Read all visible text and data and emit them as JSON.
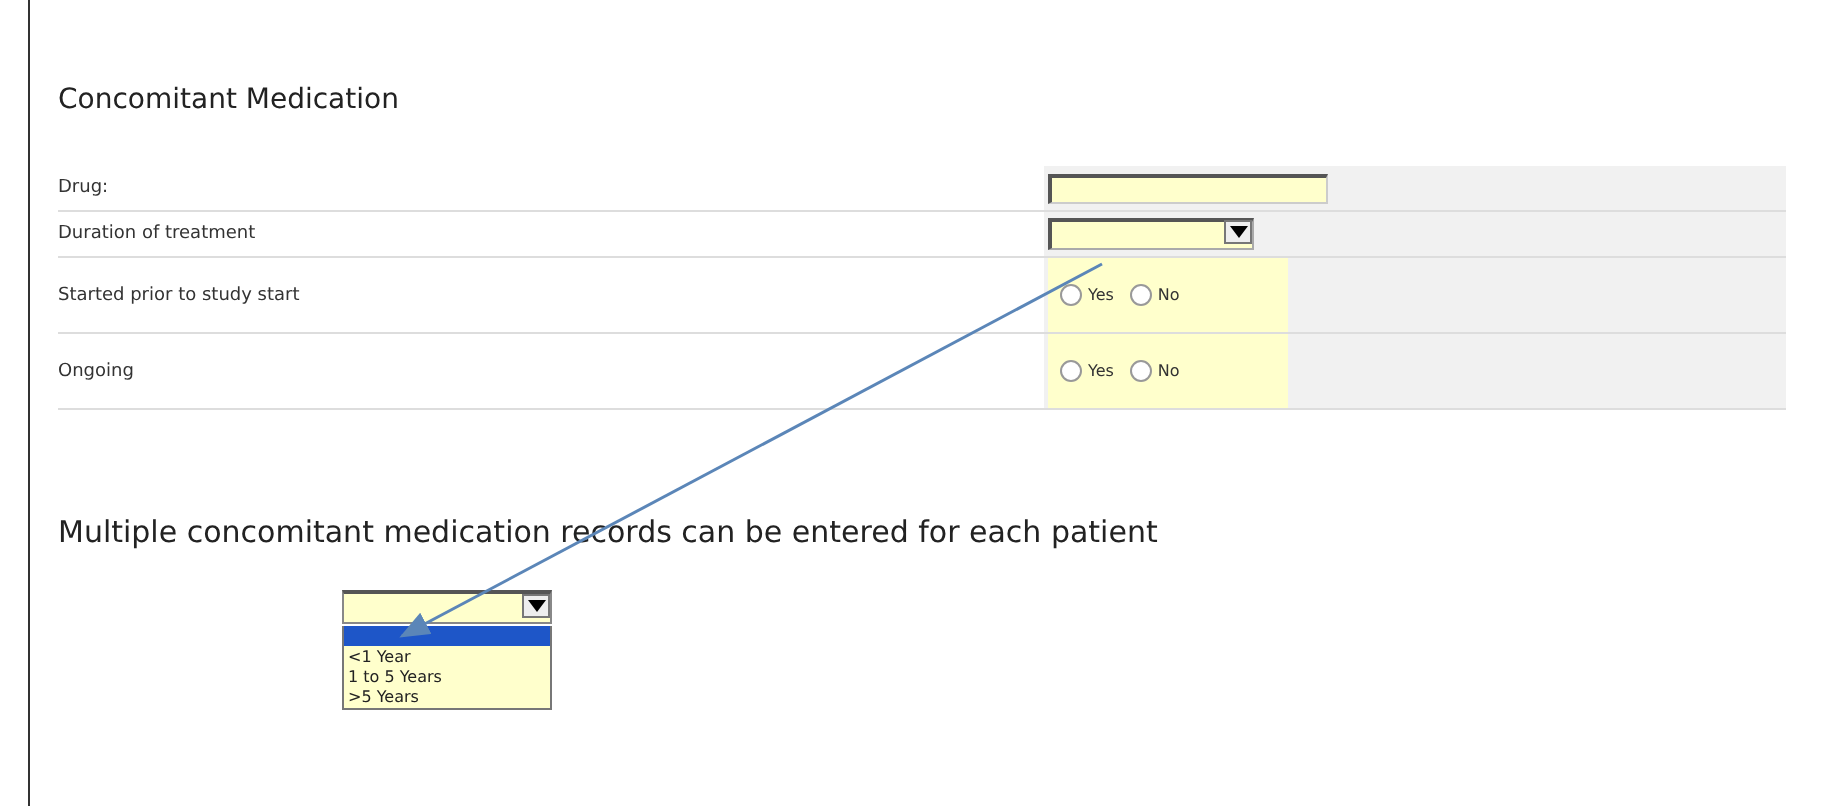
{
  "section_title": "Concomitant Medication",
  "fields": [
    {
      "label": "Drug:",
      "kind": "text"
    },
    {
      "label": "Duration of treatment",
      "kind": "select"
    },
    {
      "label": "Started prior to study start",
      "kind": "radio",
      "options": [
        {
          "label": "Yes",
          "selected": false
        },
        {
          "label": "No",
          "selected": false
        }
      ]
    },
    {
      "label": "Ongoing",
      "kind": "radio",
      "options": [
        {
          "label": "Yes",
          "selected": false
        },
        {
          "label": "No",
          "selected": false
        }
      ]
    }
  ],
  "note": "Multiple concomitant medication records can be entered for each patient",
  "dropdown": {
    "blank_highlighted": true,
    "options": [
      {
        "label": "<1 Year",
        "selected": false
      },
      {
        "label": "1 to 5 Years",
        "selected": false
      },
      {
        "label": ">5 Years",
        "selected": false
      }
    ]
  }
}
